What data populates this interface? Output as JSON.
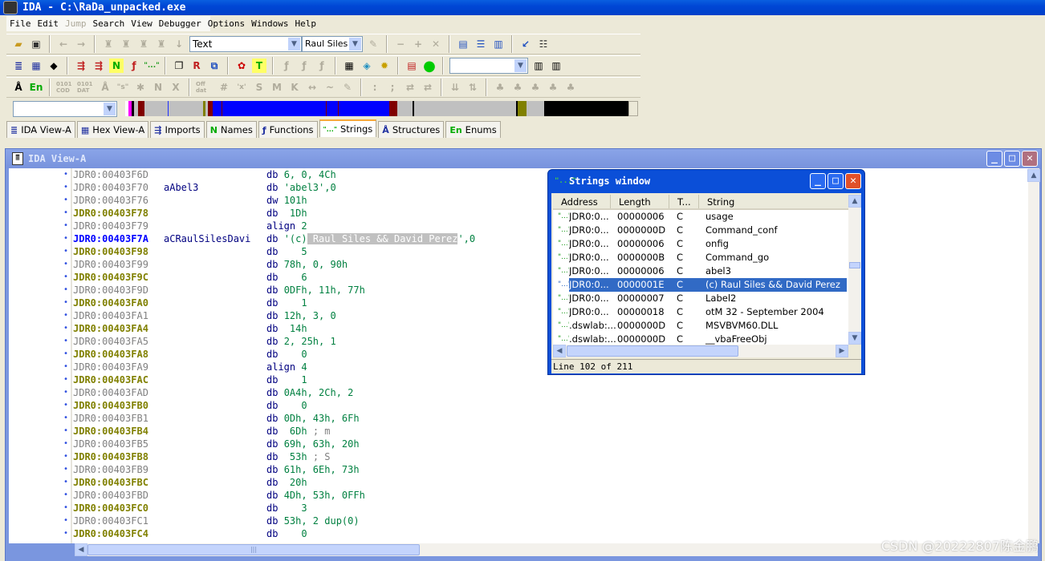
{
  "app": {
    "title": "IDA - C:\\RaDa_unpacked.exe"
  },
  "menu": [
    {
      "label": "File",
      "enabled": true
    },
    {
      "label": "Edit",
      "enabled": true
    },
    {
      "label": "Jump",
      "enabled": false
    },
    {
      "label": "Search",
      "enabled": true
    },
    {
      "label": "View",
      "enabled": true
    },
    {
      "label": "Debugger",
      "enabled": true
    },
    {
      "label": "Options",
      "enabled": true
    },
    {
      "label": "Windows",
      "enabled": true
    },
    {
      "label": "Help",
      "enabled": true
    }
  ],
  "toolbar": {
    "search_type": "Text",
    "search_value": "Raul Siles &",
    "nav_combo": "",
    "misc_combo": ""
  },
  "toolbar_labels": {
    "n": "N",
    "t": "T",
    "en": "En",
    "s": "S",
    "m": "M",
    "k": "K",
    "x": "X",
    "str": "\"...\"",
    "cod": "0101 COD",
    "dat": "0101 DAT",
    "off": "Off dat"
  },
  "tabs": [
    {
      "label": "IDA View-A",
      "icon": "document-icon",
      "glyph": "≣"
    },
    {
      "label": "Hex View-A",
      "icon": "hex-icon",
      "glyph": "▦"
    },
    {
      "label": "Imports",
      "icon": "imports-icon",
      "glyph": "⇶"
    },
    {
      "label": "Names",
      "icon": "names-icon",
      "glyph": "N"
    },
    {
      "label": "Functions",
      "icon": "function-icon",
      "glyph": "ƒ"
    },
    {
      "label": "Strings",
      "icon": "strings-icon",
      "glyph": "\"...\"",
      "active": true
    },
    {
      "label": "Structures",
      "icon": "structures-icon",
      "glyph": "Å"
    },
    {
      "label": "Enums",
      "icon": "enums-icon",
      "glyph": "En"
    }
  ],
  "ida_view": {
    "title": "IDA View-A",
    "lines": [
      {
        "addr": "JDR0:00403F6D",
        "kind": "gray",
        "label": "",
        "mnem": "db",
        "ops": "6, 0, 4Ch"
      },
      {
        "addr": "JDR0:00403F70",
        "kind": "gray",
        "label": "aAbel3",
        "mnem": "db",
        "ops": "'abel3',0"
      },
      {
        "addr": "JDR0:00403F76",
        "kind": "gray",
        "label": "",
        "mnem": "dw",
        "ops": "101h"
      },
      {
        "addr": "JDR0:00403F78",
        "kind": "olive",
        "label": "",
        "mnem": "db",
        "ops": " 1Dh"
      },
      {
        "addr": "JDR0:00403F79",
        "kind": "gray",
        "label": "",
        "mnem": "align",
        "ops": "2"
      },
      {
        "addr": "JDR0:00403F7A",
        "kind": "blue",
        "label": "aCRaulSilesDavi",
        "mnem": "db",
        "ops": "'(c)",
        "highlight": " Raul Siles && David Perez",
        "ops_after": "',0"
      },
      {
        "addr": "JDR0:00403F98",
        "kind": "olive",
        "label": "",
        "mnem": "db",
        "ops": "   5"
      },
      {
        "addr": "JDR0:00403F99",
        "kind": "gray",
        "label": "",
        "mnem": "db",
        "ops": "78h, 0, 90h"
      },
      {
        "addr": "JDR0:00403F9C",
        "kind": "olive",
        "label": "",
        "mnem": "db",
        "ops": "   6"
      },
      {
        "addr": "JDR0:00403F9D",
        "kind": "gray",
        "label": "",
        "mnem": "db",
        "ops": "0DFh, 11h, 77h"
      },
      {
        "addr": "JDR0:00403FA0",
        "kind": "olive",
        "label": "",
        "mnem": "db",
        "ops": "   1"
      },
      {
        "addr": "JDR0:00403FA1",
        "kind": "gray",
        "label": "",
        "mnem": "db",
        "ops": "12h, 3, 0"
      },
      {
        "addr": "JDR0:00403FA4",
        "kind": "olive",
        "label": "",
        "mnem": "db",
        "ops": " 14h"
      },
      {
        "addr": "JDR0:00403FA5",
        "kind": "gray",
        "label": "",
        "mnem": "db",
        "ops": "2, 25h, 1"
      },
      {
        "addr": "JDR0:00403FA8",
        "kind": "olive",
        "label": "",
        "mnem": "db",
        "ops": "   0"
      },
      {
        "addr": "JDR0:00403FA9",
        "kind": "gray",
        "label": "",
        "mnem": "align",
        "ops": "4"
      },
      {
        "addr": "JDR0:00403FAC",
        "kind": "olive",
        "label": "",
        "mnem": "db",
        "ops": "   1"
      },
      {
        "addr": "JDR0:00403FAD",
        "kind": "gray",
        "label": "",
        "mnem": "db",
        "ops": "0A4h, 2Ch, 2"
      },
      {
        "addr": "JDR0:00403FB0",
        "kind": "olive",
        "label": "",
        "mnem": "db",
        "ops": "   0"
      },
      {
        "addr": "JDR0:00403FB1",
        "kind": "gray",
        "label": "",
        "mnem": "db",
        "ops": "0Dh, 43h, 6Fh"
      },
      {
        "addr": "JDR0:00403FB4",
        "kind": "olive",
        "label": "",
        "mnem": "db",
        "ops": " 6Dh",
        "comment": " ; m"
      },
      {
        "addr": "JDR0:00403FB5",
        "kind": "gray",
        "label": "",
        "mnem": "db",
        "ops": "69h, 63h, 20h"
      },
      {
        "addr": "JDR0:00403FB8",
        "kind": "olive",
        "label": "",
        "mnem": "db",
        "ops": " 53h",
        "comment": " ; S"
      },
      {
        "addr": "JDR0:00403FB9",
        "kind": "gray",
        "label": "",
        "mnem": "db",
        "ops": "61h, 6Eh, 73h"
      },
      {
        "addr": "JDR0:00403FBC",
        "kind": "olive",
        "label": "",
        "mnem": "db",
        "ops": " 20h"
      },
      {
        "addr": "JDR0:00403FBD",
        "kind": "gray",
        "label": "",
        "mnem": "db",
        "ops": "4Dh, 53h, 0FFh"
      },
      {
        "addr": "JDR0:00403FC0",
        "kind": "olive",
        "label": "",
        "mnem": "db",
        "ops": "   3"
      },
      {
        "addr": "JDR0:00403FC1",
        "kind": "gray",
        "label": "",
        "mnem": "db",
        "ops": "53h, 2 dup(0)"
      },
      {
        "addr": "JDR0:00403FC4",
        "kind": "olive",
        "label": "",
        "mnem": "db",
        "ops": "   0"
      }
    ]
  },
  "strings_window": {
    "title": "Strings window",
    "columns": [
      "Address",
      "Length",
      "T...",
      "String"
    ],
    "rows": [
      {
        "address": "JDR0:0...",
        "length": "00000006",
        "type": "C",
        "string": "usage"
      },
      {
        "address": "JDR0:0...",
        "length": "0000000D",
        "type": "C",
        "string": "Command_conf"
      },
      {
        "address": "JDR0:0...",
        "length": "00000006",
        "type": "C",
        "string": "onfig"
      },
      {
        "address": "JDR0:0...",
        "length": "0000000B",
        "type": "C",
        "string": "Command_go"
      },
      {
        "address": "JDR0:0...",
        "length": "00000006",
        "type": "C",
        "string": "abel3"
      },
      {
        "address": "JDR0:0...",
        "length": "0000001E",
        "type": "C",
        "string": "(c) Raul Siles && David Perez",
        "selected": true
      },
      {
        "address": "JDR0:0...",
        "length": "00000007",
        "type": "C",
        "string": "Label2"
      },
      {
        "address": "JDR0:0...",
        "length": "00000018",
        "type": "C",
        "string": "otM 32 - September 2004"
      },
      {
        "address": ".dswlab:...",
        "length": "0000000D",
        "type": "C",
        "string": "MSVBVM60.DLL"
      },
      {
        "address": ".dswlab:...",
        "length": "0000000D",
        "type": "C",
        "string": "__vbaFreeObj"
      }
    ],
    "status": "Line 102 of 211"
  },
  "watermark": "CSDN @20222807陈金鹏",
  "colors": {
    "titlebar": "#0046d5",
    "address_gray": "#808080",
    "address_olive": "#808000",
    "address_current": "#0000ff",
    "mnemonic": "#000080",
    "operand": "#008040",
    "selection": "#316ac5"
  }
}
